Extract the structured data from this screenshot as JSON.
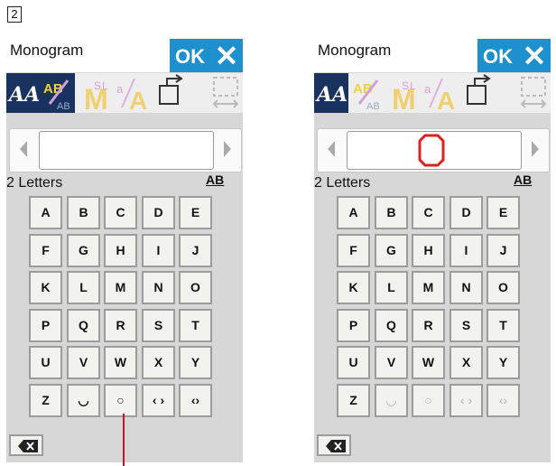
{
  "step_number": "2",
  "panels": [
    {
      "id": "left",
      "title": "Monogram",
      "ok_label": "OK",
      "close_label": "✕",
      "display_char": "",
      "count_label": "2 Letters",
      "size_label": "AB",
      "keys": [
        [
          "A",
          "B",
          "C",
          "D",
          "E"
        ],
        [
          "F",
          "G",
          "H",
          "I",
          "J"
        ],
        [
          "K",
          "L",
          "M",
          "N",
          "O"
        ],
        [
          "P",
          "Q",
          "R",
          "S",
          "T"
        ],
        [
          "U",
          "V",
          "W",
          "X",
          "Y"
        ],
        [
          "Z",
          "◡",
          "○",
          "‹ ›",
          "‹›"
        ]
      ],
      "disabled_keys": []
    },
    {
      "id": "right",
      "title": "Monogram",
      "ok_label": "OK",
      "close_label": "✕",
      "display_char": "O",
      "count_label": "2 Letters",
      "size_label": "AB",
      "keys": [
        [
          "A",
          "B",
          "C",
          "D",
          "E"
        ],
        [
          "F",
          "G",
          "H",
          "I",
          "J"
        ],
        [
          "K",
          "L",
          "M",
          "N",
          "O"
        ],
        [
          "P",
          "Q",
          "R",
          "S",
          "T"
        ],
        [
          "U",
          "V",
          "W",
          "X",
          "Y"
        ],
        [
          "Z",
          "◡",
          "○",
          "‹ ›",
          "‹›"
        ]
      ],
      "disabled_keys": [
        "◡",
        "○",
        "‹ ›",
        "‹›"
      ]
    }
  ],
  "colors": {
    "accent": "#1e90cd",
    "active_tool": "#1a3260",
    "display_glyph": "#e0201c",
    "pointer": "#c8102e"
  },
  "icons": [
    "font-style-icon",
    "letter-arrangement-icon",
    "monogram-size-icon",
    "letter-spacing-icon",
    "mirror-icon",
    "layout-icon",
    "backspace-icon"
  ]
}
